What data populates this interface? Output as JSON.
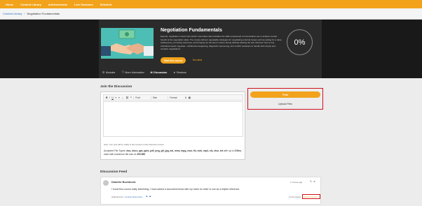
{
  "nav": {
    "items": [
      "Home",
      "Content Library",
      "Achievements",
      "Live Sessions",
      "Selected"
    ]
  },
  "breadcrumb": {
    "parent": "Content Library",
    "separator": "/",
    "current": "Negotiation Fundamentals"
  },
  "course": {
    "title": "Negotiation Fundamentals",
    "description": "Experts, negotiation mould, best author Lisa Gates demonstrates the skills empowered communication are to achieve mutual benefit at the negotiation table. The course delivers repeatable strategies for negotiating external issues such as asking for a raise, settling fees, promoting outcomes, and bringing out the best in others during delicate sticking the ask. Discover how to use individual Impact negotiate - distributive bargaining, diagnostic sponsoring, and conflict resolution to handle both simple and complex negotiations.",
    "start_label": "Start this course",
    "enrolled_label": "Enrolled",
    "progress": "0%",
    "progress_value": 0
  },
  "tabs": [
    {
      "label": "Modules",
      "icon": "list-icon"
    },
    {
      "label": "More Information",
      "icon": "info-icon"
    },
    {
      "label": "Discussion",
      "icon": "chat-icon"
    },
    {
      "label": "Reviews",
      "icon": "star-icon"
    }
  ],
  "discussion": {
    "title": "Join the Discussion",
    "toolbar": {
      "buttons": [
        "B",
        "I",
        "U",
        "≡",
        "≡",
        "⇔",
        "⛓",
        "❝"
      ],
      "font_dropdown": "Font",
      "size_dropdown": "Size",
      "format_dropdown": "Format",
      "color_label": "A"
    },
    "note": "Note: Your post will be visible to all members of this discussion board.",
    "accepted_label": "Accepted File Types:",
    "accepted_types": "doc, docx, ppt, pptx, pdf, png, gif, jpg, avi, wmv, mpg, mov, flv, m4v, mp4, xls, xlsx, txt",
    "max_size_prefix": "with up to",
    "max_files": "3 files",
    "max_size_mid": ", each with maximum file size of",
    "max_size": "200 MB",
    "post_label": "Post",
    "upload_label": "Upload Files"
  },
  "feed": {
    "title": "Discussion Feed",
    "post": {
      "author": "Danielle Buckhurst",
      "time": "1 minute ago",
      "comment": "I found this course really interesting. I have added a document below with my notes for other to use as a helpful reference.",
      "attachments_label": "Attachments:",
      "attachment_name": "Course Notes.docx",
      "comments_count": "0 Comments",
      "add_comment": "Add Comment"
    }
  },
  "colors": {
    "accent": "#f2a31b",
    "highlight_box": "#d10f1a",
    "hero_bg": "#191919"
  }
}
